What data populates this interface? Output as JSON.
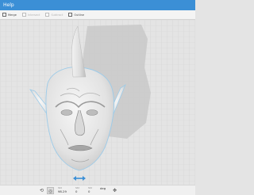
{
  "window": {
    "title": "Help"
  },
  "toolbar": {
    "items": [
      {
        "label": "Merge",
        "enabled": true
      },
      {
        "label": "Intersect",
        "enabled": false
      },
      {
        "label": "Subtract",
        "enabled": false
      },
      {
        "label": "Outline",
        "enabled": true
      }
    ]
  },
  "viewport": {
    "model": "creature-head-with-horn",
    "gizmo": "move-arrows-icon"
  },
  "statusbar": {
    "icons": {
      "left": "rotate-icon",
      "active": "orbit-icon",
      "right": "pan-icon"
    },
    "fields": [
      {
        "label": "Std",
        "value": "98.29"
      },
      {
        "label": "Std",
        "value": "0"
      },
      {
        "label": "Std",
        "value": "0"
      },
      {
        "label": "",
        "value": "deg"
      }
    ]
  },
  "colors": {
    "accent": "#3b8fd6",
    "model": "#e9e9e9",
    "shadow": "#c9c9c9",
    "grid": "#d2d2d2"
  }
}
